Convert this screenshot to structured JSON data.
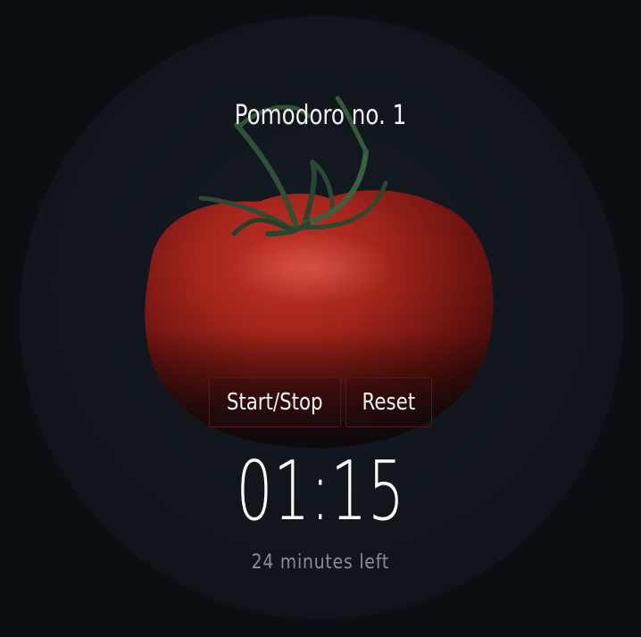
{
  "title": "Pomodoro no. 1",
  "controls": {
    "start_stop_label": "Start/Stop",
    "reset_label": "Reset"
  },
  "timer": {
    "display": "01:15",
    "remaining_text": "24 minutes left"
  },
  "theme": {
    "background": "#0b0f13",
    "button_border": "#4a1c1e",
    "tomato_red": "#b8271c"
  },
  "background_image": "tomato-photo"
}
